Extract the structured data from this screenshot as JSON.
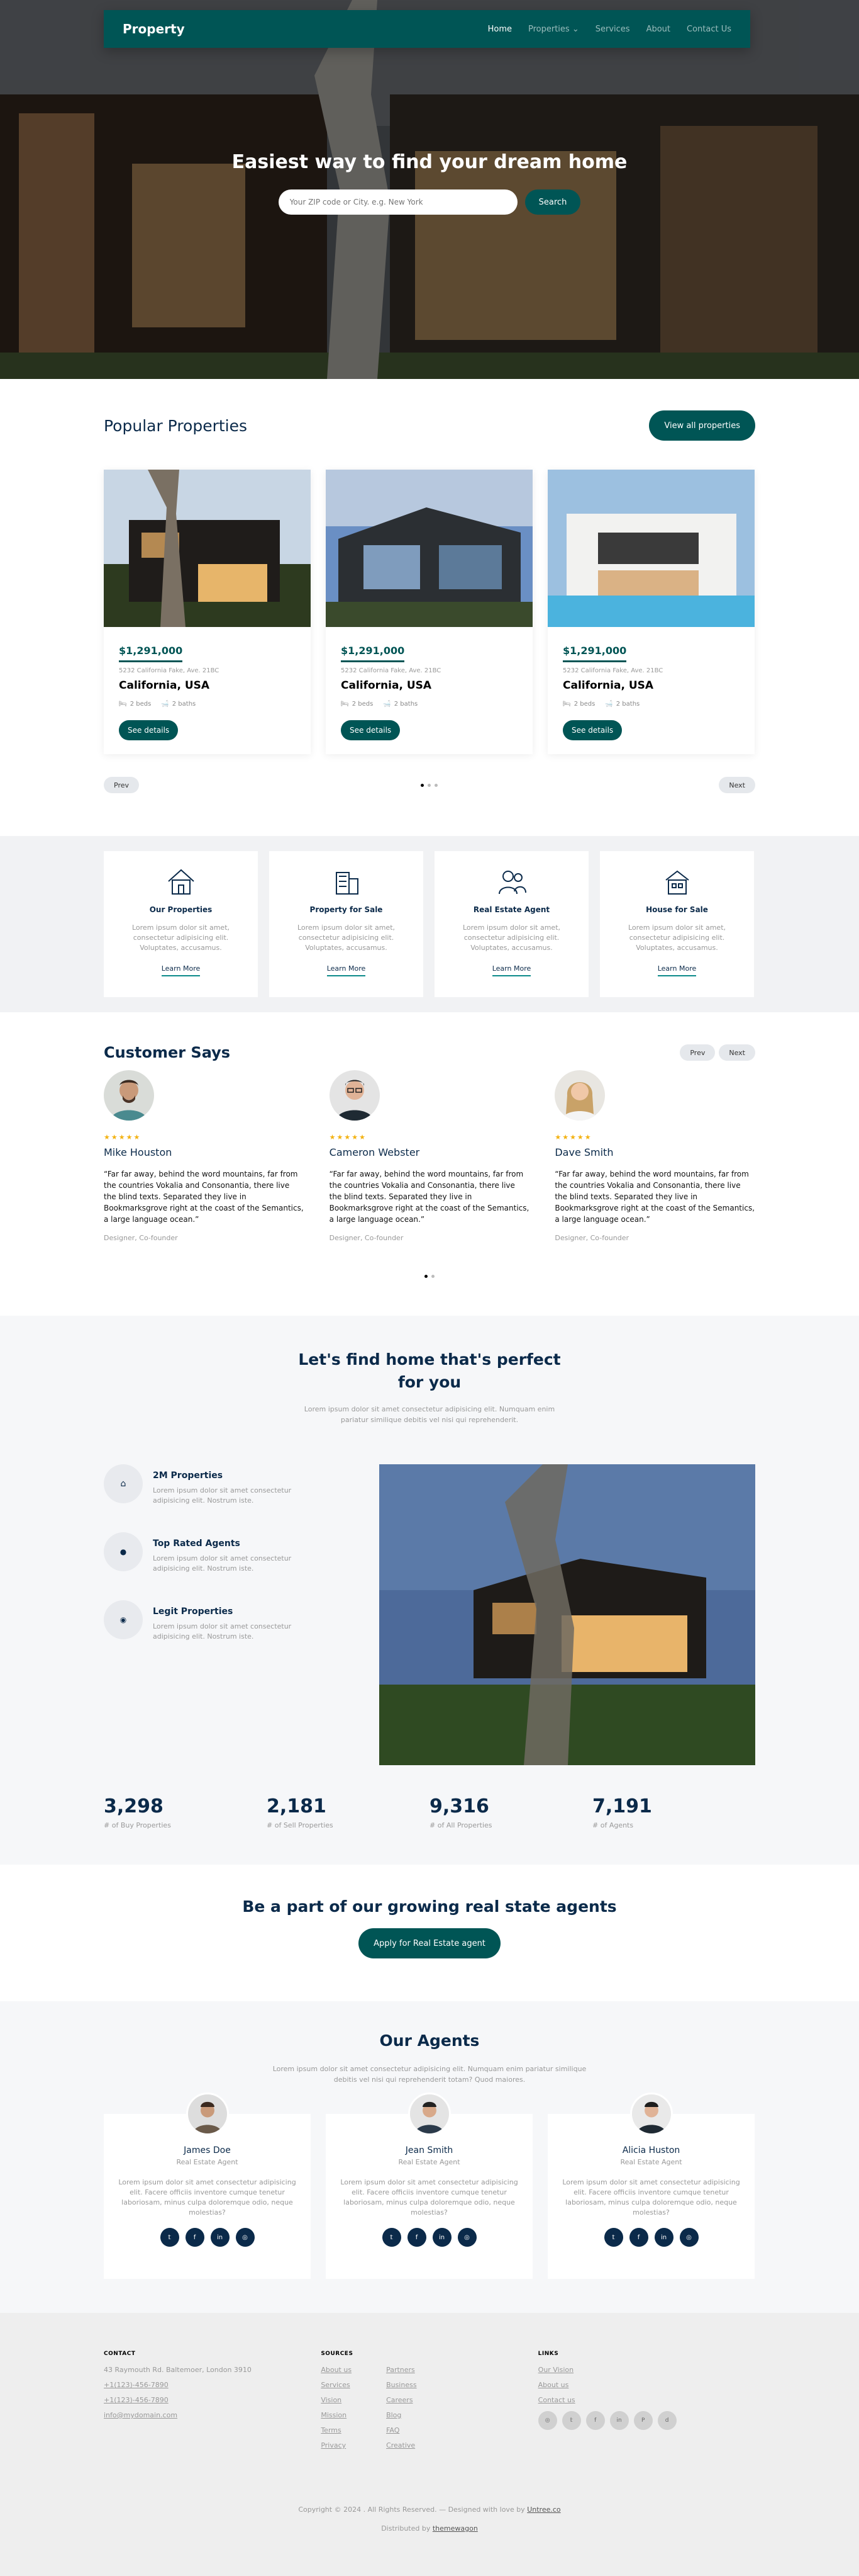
{
  "nav": {
    "logo": "Property",
    "links": [
      "Home",
      "Properties",
      "Services",
      "About",
      "Contact Us"
    ]
  },
  "hero": {
    "title": "Easiest way to find your dream home",
    "search_placeholder": "Your ZIP code or City. e.g. New York",
    "search_button": "Search"
  },
  "popular": {
    "title": "Popular Properties",
    "view_all": "View all properties",
    "cards": [
      {
        "price": "$1,291,000",
        "address": "5232 California Fake, Ave. 21BC",
        "city": "California, USA",
        "beds": "2 beds",
        "baths": "2 baths",
        "button": "See details"
      },
      {
        "price": "$1,291,000",
        "address": "5232 California Fake, Ave. 21BC",
        "city": "California, USA",
        "beds": "2 beds",
        "baths": "2 baths",
        "button": "See details"
      },
      {
        "price": "$1,291,000",
        "address": "5232 California Fake, Ave. 21BC",
        "city": "California, USA",
        "beds": "2 beds",
        "baths": "2 baths",
        "button": "See details"
      }
    ],
    "prev": "Prev",
    "next": "Next"
  },
  "features": [
    {
      "title": "Our Properties",
      "text": "Lorem ipsum dolor sit amet, consectetur adipisicing elit. Voluptates, accusamus.",
      "link": "Learn More"
    },
    {
      "title": "Property for Sale",
      "text": "Lorem ipsum dolor sit amet, consectetur adipisicing elit. Voluptates, accusamus.",
      "link": "Learn More"
    },
    {
      "title": "Real Estate Agent",
      "text": "Lorem ipsum dolor sit amet, consectetur adipisicing elit. Voluptates, accusamus.",
      "link": "Learn More"
    },
    {
      "title": "House for Sale",
      "text": "Lorem ipsum dolor sit amet, consectetur adipisicing elit. Voluptates, accusamus.",
      "link": "Learn More"
    }
  ],
  "testimonials": {
    "title": "Customer Says",
    "prev": "Prev",
    "next": "Next",
    "items": [
      {
        "stars": "★★★★★",
        "name": "Mike Houston",
        "quote": "“Far far away, behind the word mountains, far from the countries Vokalia and Consonantia, there live the blind texts. Separated they live in Bookmarksgrove right at the coast of the Semantics, a large language ocean.”",
        "role": "Designer, Co-founder"
      },
      {
        "stars": "★★★★★",
        "name": "Cameron Webster",
        "quote": "“Far far away, behind the word mountains, far from the countries Vokalia and Consonantia, there live the blind texts. Separated they live in Bookmarksgrove right at the coast of the Semantics, a large language ocean.”",
        "role": "Designer, Co-founder"
      },
      {
        "stars": "★★★★★",
        "name": "Dave Smith",
        "quote": "“Far far away, behind the word mountains, far from the countries Vokalia and Consonantia, there live the blind texts. Separated they live in Bookmarksgrove right at the coast of the Semantics, a large language ocean.”",
        "role": "Designer, Co-founder"
      }
    ]
  },
  "find": {
    "title": "Let's find home that's perfect for you",
    "subtitle": "Lorem ipsum dolor sit amet consectetur adipisicing elit. Numquam enim pariatur similique debitis vel nisi qui reprehenderit.",
    "items": [
      {
        "title": "2M Properties",
        "text": "Lorem ipsum dolor sit amet consectetur adipisicing elit. Nostrum iste."
      },
      {
        "title": "Top Rated Agents",
        "text": "Lorem ipsum dolor sit amet consectetur adipisicing elit. Nostrum iste."
      },
      {
        "title": "Legit Properties",
        "text": "Lorem ipsum dolor sit amet consectetur adipisicing elit. Nostrum iste."
      }
    ],
    "stats": [
      {
        "num": "3,298",
        "label": "# of Buy Properties"
      },
      {
        "num": "2,181",
        "label": "# of Sell Properties"
      },
      {
        "num": "9,316",
        "label": "# of All Properties"
      },
      {
        "num": "7,191",
        "label": "# of Agents"
      }
    ]
  },
  "cta": {
    "title": "Be a part of our growing real state agents",
    "button": "Apply for Real Estate agent"
  },
  "agents": {
    "title": "Our Agents",
    "subtitle": "Lorem ipsum dolor sit amet consectetur adipisicing elit. Numquam enim pariatur similique debitis vel nisi qui reprehenderit totam? Quod maiores.",
    "items": [
      {
        "name": "James Doe",
        "role": "Real Estate Agent",
        "text": "Lorem ipsum dolor sit amet consectetur adipisicing elit. Facere officiis inventore cumque tenetur laboriosam, minus culpa doloremque odio, neque molestias?"
      },
      {
        "name": "Jean Smith",
        "role": "Real Estate Agent",
        "text": "Lorem ipsum dolor sit amet consectetur adipisicing elit. Facere officiis inventore cumque tenetur laboriosam, minus culpa doloremque odio, neque molestias?"
      },
      {
        "name": "Alicia Huston",
        "role": "Real Estate Agent",
        "text": "Lorem ipsum dolor sit amet consectetur adipisicing elit. Facere officiis inventore cumque tenetur laboriosam, minus culpa doloremque odio, neque molestias?"
      }
    ],
    "social_icons": [
      "twitter-icon",
      "facebook-icon",
      "linkedin-icon",
      "instagram-icon"
    ],
    "social_glyphs": [
      "𝕥",
      "f",
      "in",
      "◎"
    ]
  },
  "footer": {
    "contact_head": "CONTACT",
    "address": "43 Raymouth Rd. Baltemoer, London 3910",
    "phones": [
      "+1(123)-456-7890",
      "+1(123)-456-7890"
    ],
    "email": "info@mydomain.com",
    "sources_head": "SOURCES",
    "sources_a": [
      "About us",
      "Services",
      "Vision",
      "Mission",
      "Terms",
      "Privacy"
    ],
    "sources_b": [
      "Partners",
      "Business",
      "Careers",
      "Blog",
      "FAQ",
      "Creative"
    ],
    "links_head": "LINKS",
    "links": [
      "Our Vision",
      "About us",
      "Contact us"
    ],
    "social_glyphs": [
      "◎",
      "𝕥",
      "f",
      "in",
      "P",
      "d"
    ],
    "copyright": "Copyright © 2024 . All Rights Reserved. — Designed with love by",
    "designer": "Untree.co",
    "distributed_prefix": "Distributed by",
    "distributor": "themewagon"
  },
  "colors": {
    "brand": "#005555",
    "navy": "#0b2a4a",
    "star": "#f3b212"
  }
}
